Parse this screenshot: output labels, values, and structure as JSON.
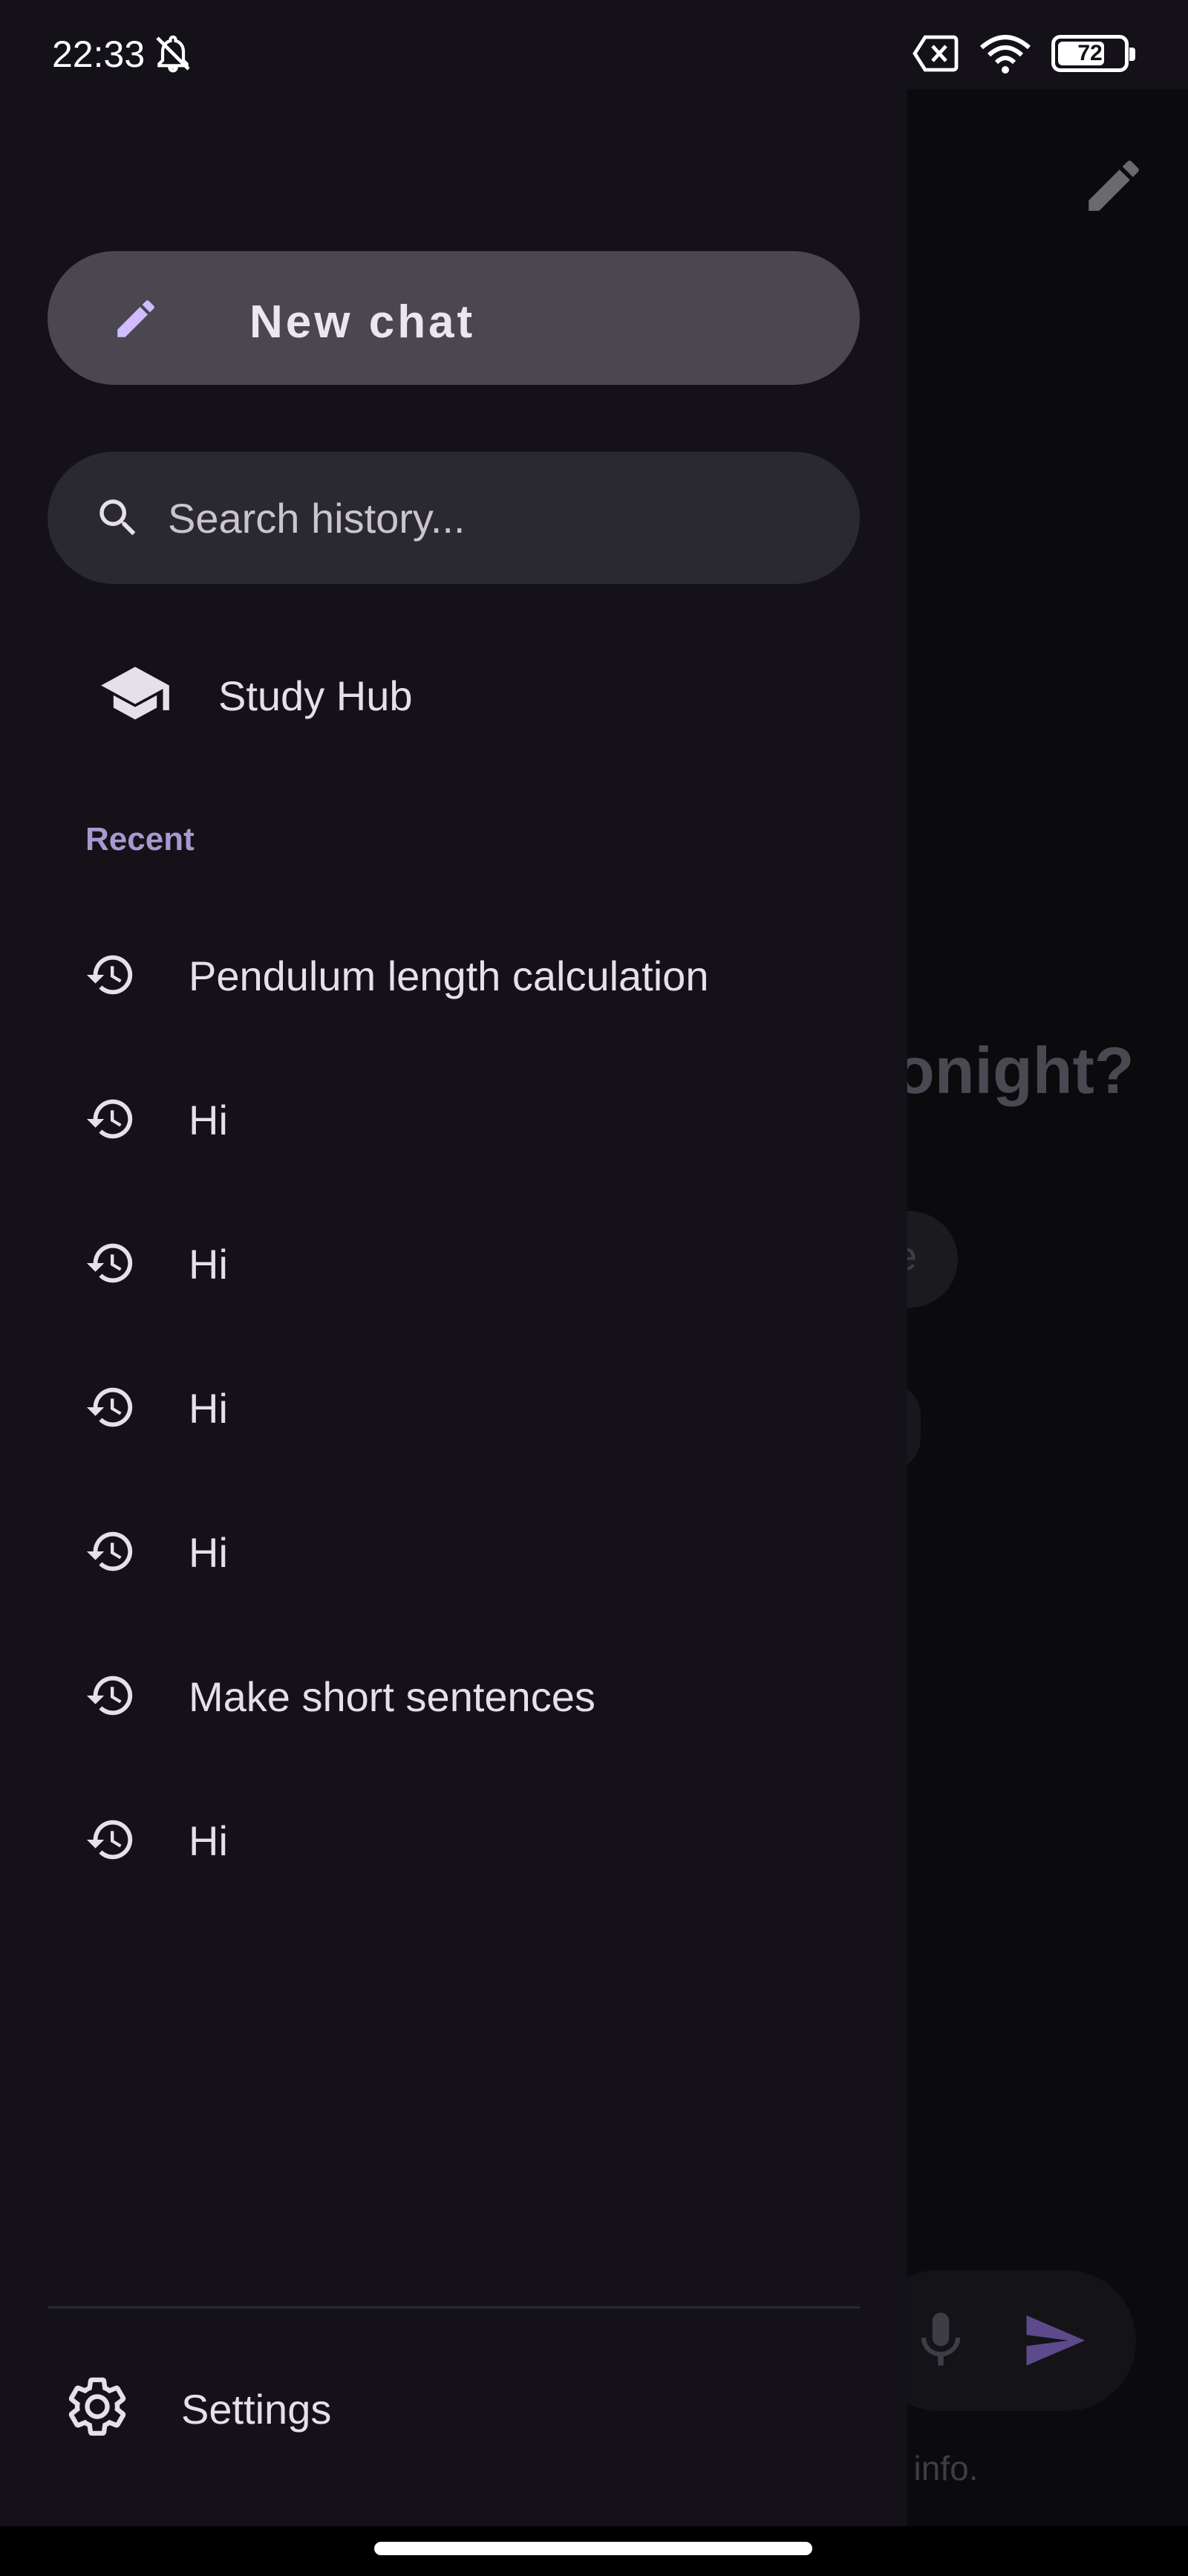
{
  "status_bar": {
    "time": "22:33",
    "battery_level": "72",
    "battery_fraction": 0.72
  },
  "drawer": {
    "new_chat_label": "New chat",
    "search_placeholder": "Search history...",
    "study_hub_label": "Study Hub",
    "recent_section_label": "Recent",
    "recent_items": [
      {
        "label": "Pendulum length calculation"
      },
      {
        "label": "Hi"
      },
      {
        "label": "Hi"
      },
      {
        "label": "Hi"
      },
      {
        "label": "Hi"
      },
      {
        "label": "Make short sentences"
      },
      {
        "label": "Hi"
      }
    ],
    "settings_label": "Settings"
  },
  "background": {
    "heading_fragment": "onight?",
    "chip_fragment": "e",
    "info_fragment": "t info."
  },
  "colors": {
    "accent": "#d0bcff",
    "background": "#141218",
    "new_chat_button": "#4a4750",
    "search_box": "#2b2930",
    "recent_label": "#a699d0",
    "send_icon": "#5c4a8c"
  },
  "icons": {
    "new_chat": "pencil-icon",
    "search": "search-icon",
    "study_hub": "graduation-cap-icon",
    "recent_item": "history-icon",
    "settings": "gear-icon",
    "background_edit": "pencil-icon",
    "background_mic": "microphone-icon",
    "background_send": "send-icon"
  }
}
